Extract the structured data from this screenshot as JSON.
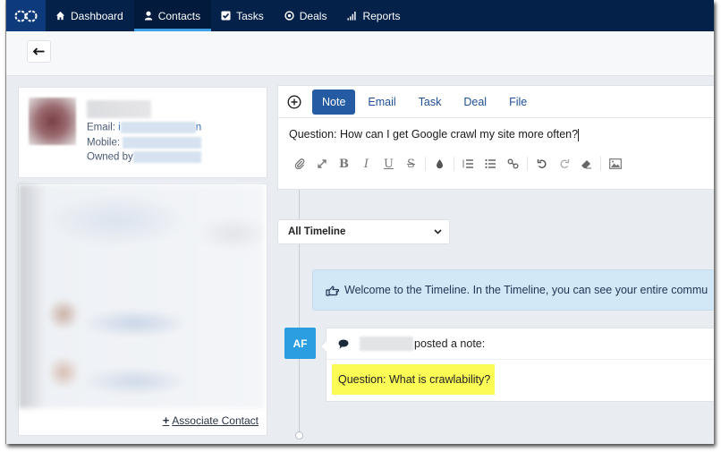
{
  "nav": {
    "items": [
      {
        "label": "Dashboard",
        "icon": "home-icon",
        "active": false
      },
      {
        "label": "Contacts",
        "icon": "user-icon",
        "active": true
      },
      {
        "label": "Tasks",
        "icon": "checkbox-icon",
        "active": false
      },
      {
        "label": "Deals",
        "icon": "target-icon",
        "active": false
      },
      {
        "label": "Reports",
        "icon": "bar-chart-icon",
        "active": false
      }
    ],
    "accent": "#3ba0e6",
    "background": "#04214a"
  },
  "subheader": {
    "back_icon": "arrow-left-icon"
  },
  "contact": {
    "email_label": "Email:",
    "email_lead": "i",
    "email_tail": "n",
    "mobile_label": "Mobile:",
    "owner_label": "Owned by"
  },
  "associations": {
    "add_label": "Associate Contact"
  },
  "compose": {
    "tabs": [
      {
        "label": "Note",
        "active": true
      },
      {
        "label": "Email",
        "active": false
      },
      {
        "label": "Task",
        "active": false
      },
      {
        "label": "Deal",
        "active": false
      },
      {
        "label": "File",
        "active": false
      }
    ],
    "text": "Question: How can I get Google crawl my site more often?",
    "toolbar": [
      "paperclip-icon",
      "expand-icon",
      "bold-icon",
      "italic-icon",
      "underline-icon",
      "strikethrough-icon",
      "color-drop-icon",
      "ordered-list-icon",
      "bullet-list-icon",
      "link-icon",
      "undo-icon",
      "redo-icon",
      "eraser-icon",
      "image-icon"
    ]
  },
  "timeline": {
    "filter_value": "All Timeline",
    "welcome": "Welcome to the Timeline. In the Timeline, you can see your entire commu",
    "entries": [
      {
        "initials": "AF",
        "action": "posted a note:",
        "note": "Question: What is crawlability?",
        "badge_color": "#2a9ee0",
        "highlight_color": "#fbfb56"
      }
    ]
  }
}
